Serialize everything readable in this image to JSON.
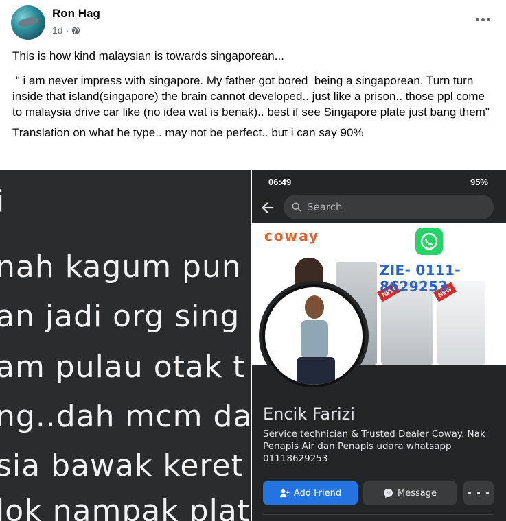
{
  "post": {
    "author": "Ron Hag",
    "time": "1d",
    "privacy_icon": "globe-icon",
    "more_icon": "more-horizontal-icon",
    "paragraphs": {
      "intro": "This is how kind malaysian is towards singaporean...",
      "quote": " \" i am never impress with singapore. My father got bored  being a singaporean. Turn turn inside that island(singapore) the brain cannot developed.. just like a prison.. those ppl come to malaysia drive car like (no idea wat is benak).. best if see Singapore plate just bang them\"",
      "translation_note": "Translation on what he type.. may not be perfect.. but i can say 90%"
    }
  },
  "left_image": {
    "lines": [
      "i",
      "nah kagum pun",
      "an jadi org sing",
      "am pulau otak t",
      "ng..dah mcm dal",
      "sia bawak keret",
      "lok nampak plat"
    ]
  },
  "right_image": {
    "status_bar": {
      "time": "06:49",
      "battery": "95%"
    },
    "search": {
      "placeholder": "Search"
    },
    "cover": {
      "brand": "coway",
      "phone_text": "ZIE- 0111-8629253",
      "tag": "NEW"
    },
    "profile": {
      "name": "Encik Farizi",
      "bio": "Service technician & Trusted Dealer Coway. Nak Penapis Air dan Penapis udara whatsapp 01118629253"
    },
    "actions": {
      "add_friend": "Add Friend",
      "message": "Message"
    },
    "colors": {
      "primary_button": "#2374e1",
      "dark_bg": "#242526",
      "brand_orange": "#e95f2f"
    }
  }
}
